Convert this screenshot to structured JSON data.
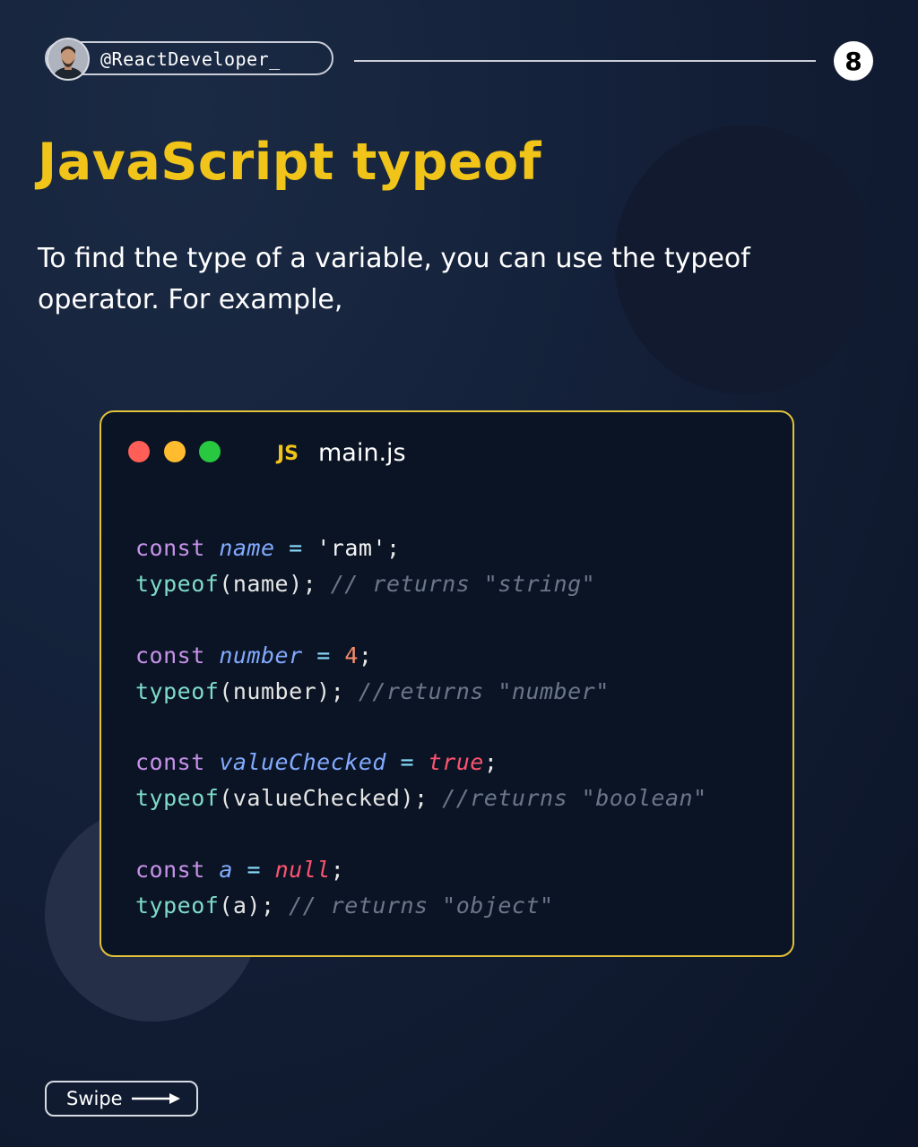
{
  "header": {
    "handle": "@ReactDeveloper_",
    "page_number": "8"
  },
  "title": "JavaScript typeof",
  "intro": "To find the type of a variable, you can use the typeof operator. For example,",
  "code_window": {
    "icon_label": "JS",
    "filename": "main.js",
    "lines": {
      "l1": {
        "kw": "const",
        "var": "name",
        "op": "=",
        "val": "'ram'",
        "end": ";"
      },
      "l2": {
        "fn": "typeof",
        "arg": "(name);",
        "cmt": "// returns \"string\""
      },
      "l3": {
        "kw": "const",
        "var": "number",
        "op": "=",
        "val": "4",
        "end": ";"
      },
      "l4": {
        "fn": "typeof",
        "arg": "(number);",
        "cmt": "//returns \"number\""
      },
      "l5": {
        "kw": "const",
        "var": "valueChecked",
        "op": "=",
        "val": "true",
        "end": ";"
      },
      "l6": {
        "fn": "typeof",
        "arg": "(valueChecked);",
        "cmt": "//returns \"boolean\""
      },
      "l7": {
        "kw": "const",
        "var": "a",
        "op": "=",
        "val": "null",
        "end": ";"
      },
      "l8": {
        "fn": "typeof",
        "arg": "(a);",
        "cmt": "// returns \"object\""
      }
    }
  },
  "footer": {
    "swipe_label": "Swipe"
  },
  "colors": {
    "accent": "#f0c419",
    "background": "#14213a",
    "code_background": "#0b1424"
  }
}
